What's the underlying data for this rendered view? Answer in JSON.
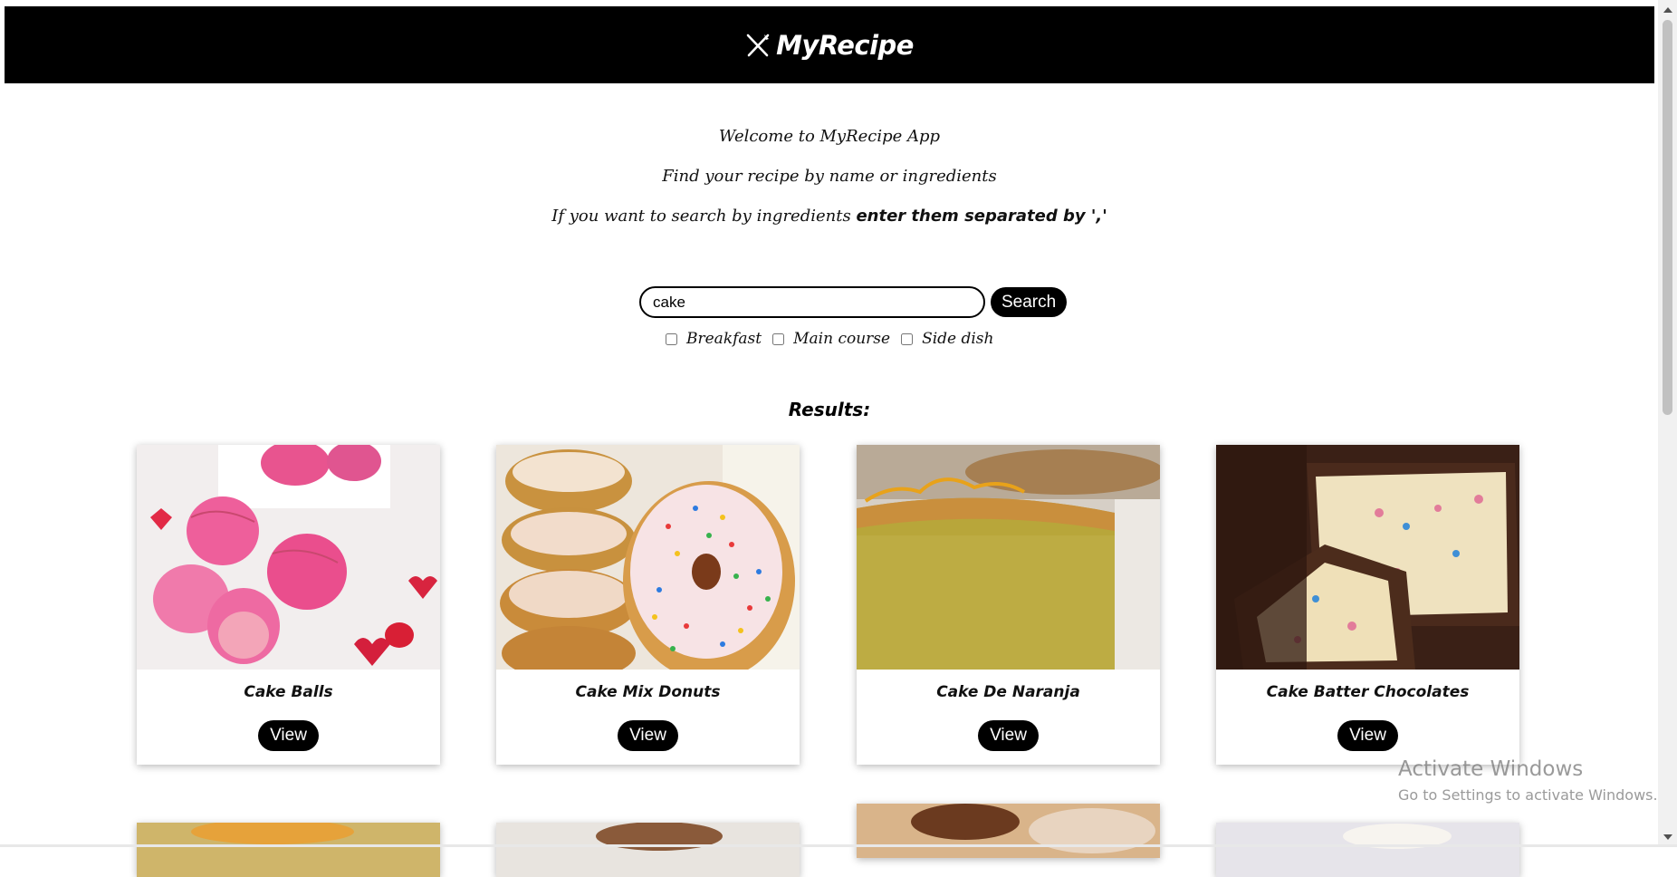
{
  "header": {
    "title": "MyRecipe",
    "icon": "fork-knife-icon"
  },
  "intro": {
    "line1": "Welcome to MyRecipe App",
    "line2": "Find your recipe by name or ingredients",
    "line3_prefix": "If you want to search by ingredients",
    "line3_bold": "enter them separated by ','"
  },
  "search": {
    "value": "cake",
    "placeholder": "",
    "button_label": "Search"
  },
  "filters": [
    {
      "label": "Breakfast",
      "checked": false
    },
    {
      "label": "Main course",
      "checked": false
    },
    {
      "label": "Side dish",
      "checked": false
    }
  ],
  "results": {
    "title": "Results:",
    "view_label": "View",
    "cards": [
      {
        "name": "Cake Balls",
        "image": "pink-cake-balls-photo"
      },
      {
        "name": "Cake Mix Donuts",
        "image": "sprinkle-donuts-photo"
      },
      {
        "name": "Cake De Naranja",
        "image": "orange-cake-slice-photo"
      },
      {
        "name": "Cake Batter Chocolates",
        "image": "chocolate-bites-photo"
      }
    ]
  },
  "watermark": {
    "title": "Activate Windows",
    "subtitle": "Go to Settings to activate Windows."
  },
  "colors": {
    "header_bg": "#000000",
    "button_bg": "#000000",
    "button_text": "#ffffff"
  }
}
